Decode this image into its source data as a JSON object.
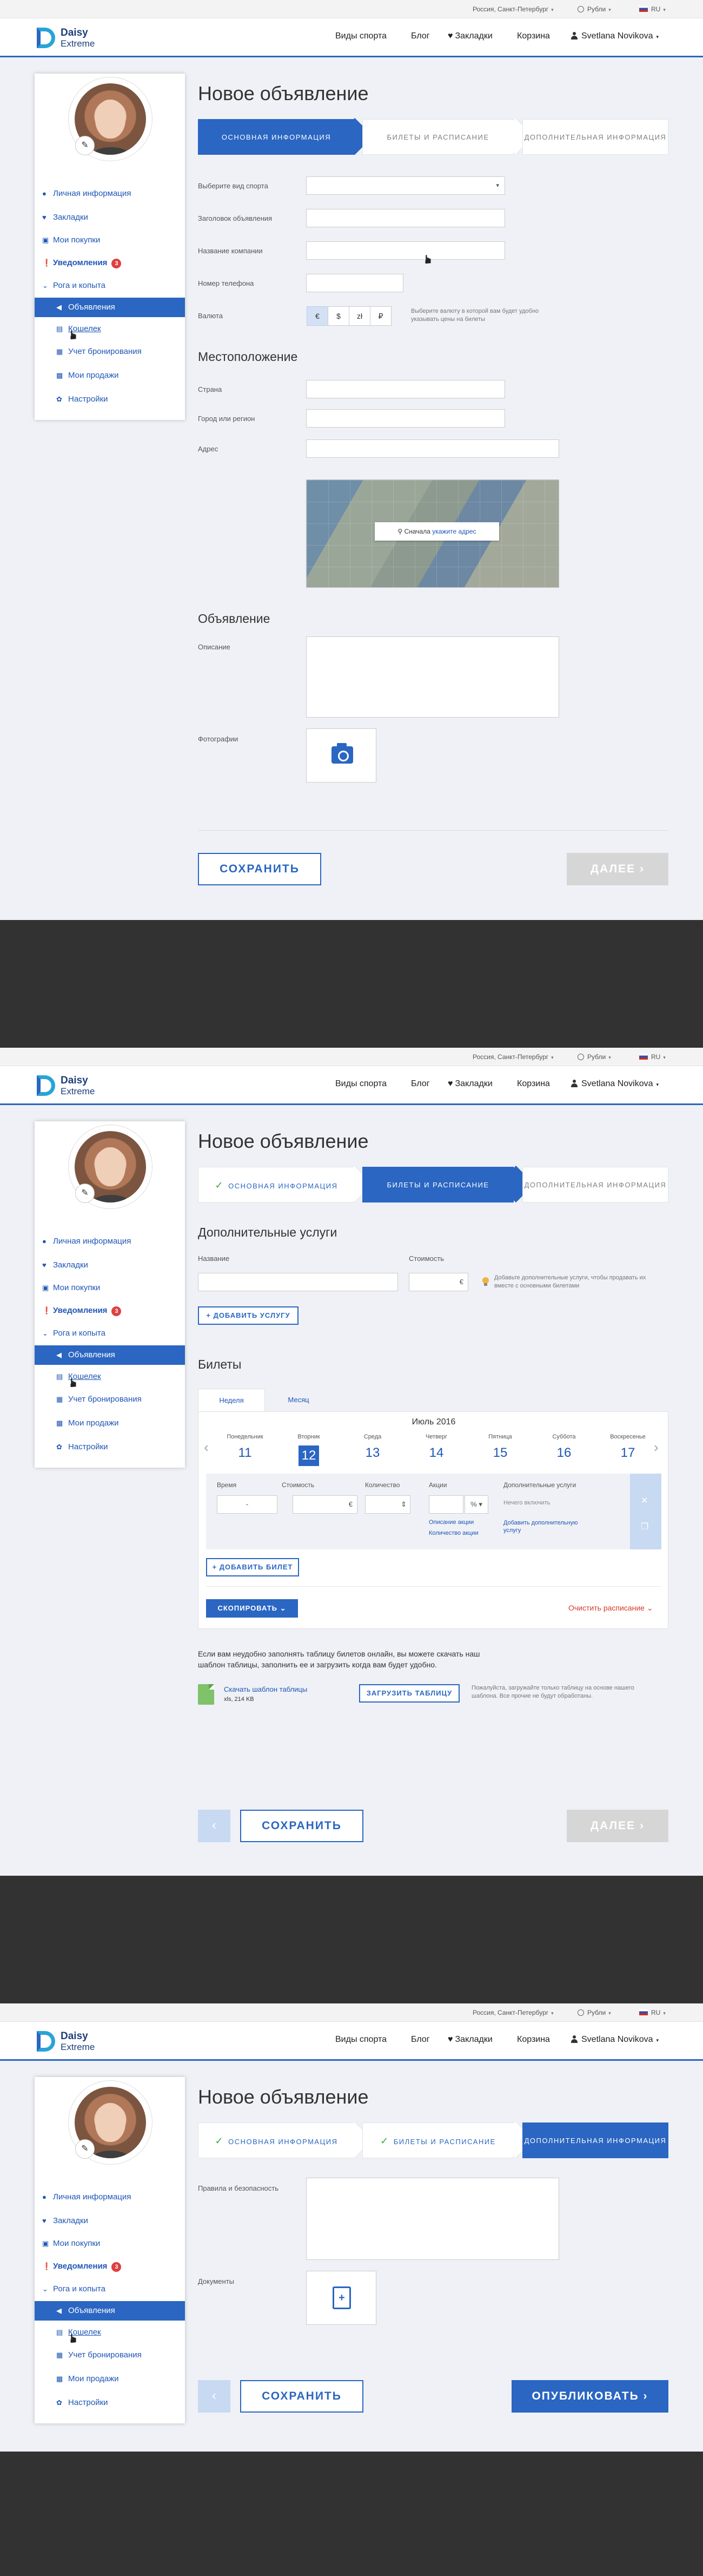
{
  "topbar": {
    "location": "Россия, Санкт-Петербург",
    "currency": "Рубли",
    "language": "RU"
  },
  "header": {
    "logo_line1": "Daisy",
    "logo_line2": "Extreme",
    "nav": [
      "Виды спорта",
      "Блог",
      "Закладки",
      "Корзина"
    ],
    "user": "Svetlana Novikova"
  },
  "sidebar": {
    "personal": "Личная информация",
    "bookmarks": "Закладки",
    "purchases": "Мои покупки",
    "notifications": "Уведомления",
    "notifications_count": "3",
    "group": "Рога и копыта",
    "ads": "Объявления",
    "wallet": "Кошелек",
    "booking": "Учет бронирования",
    "sales": "Мои продажи",
    "settings": "Настройки"
  },
  "page": {
    "title": "Новое объявление"
  },
  "steps": {
    "step1": "ОСНОВНАЯ ИНФОРМАЦИЯ",
    "step2": "БИЛЕТЫ И РАСПИСАНИЕ",
    "step3": "ДОПОЛНИТЕЛЬНАЯ ИНФОРМАЦИЯ"
  },
  "screen1": {
    "sport_label": "Выберите вид спорта",
    "headline_label": "Заголовок объявления",
    "company_label": "Название компании",
    "phone_label": "Номер телефона",
    "currency_label": "Валюта",
    "currency_options": [
      "€",
      "$",
      "zł",
      "₽"
    ],
    "currency_hint": "Выберите валюту в которой вам будет удобно указывать цены на билеты",
    "location_heading": "Местоположение",
    "country_label": "Страна",
    "city_label": "Город или регион",
    "address_label": "Адрес",
    "map_hint": "Сначала",
    "map_hint_link": "укажите адрес",
    "ad_heading": "Объявление",
    "description_label": "Описание",
    "photos_label": "Фотографии",
    "save": "СОХРАНИТЬ",
    "next": "ДАЛЕЕ"
  },
  "screen2": {
    "services_heading": "Дополнительные услуги",
    "name_label": "Название",
    "cost_label": "Стоимость",
    "cost_currency": "€",
    "services_hint": "Добавьте дополнительные услуги, чтобы продавать их вместе с основными билетами",
    "add_service": "+ ДОБАВИТЬ УСЛУГУ",
    "tickets_heading": "Билеты",
    "tab_week": "Неделя",
    "tab_month": "Месяц",
    "month": "Июль 2016",
    "days": [
      {
        "name": "Понедельник",
        "date": "11"
      },
      {
        "name": "Вторник",
        "date": "12"
      },
      {
        "name": "Среда",
        "date": "13"
      },
      {
        "name": "Четверг",
        "date": "14"
      },
      {
        "name": "Пятница",
        "date": "15"
      },
      {
        "name": "Суббота",
        "date": "16"
      },
      {
        "name": "Воскресенье",
        "date": "17"
      }
    ],
    "col_time": "Время",
    "col_cost": "Стоимость",
    "col_qty": "Количество",
    "col_promo": "Акции",
    "col_extra": "Дополнительные услуги",
    "time_value": "-",
    "cost_currency_small": "€",
    "promo_unit": "%",
    "promo_desc": "Описание акции",
    "promo_qty": "Количество акции",
    "extra_empty": "Нечего включить",
    "extra_add": "Добавить дополнительную услугу",
    "add_ticket": "+ ДОБАВИТЬ БИЛЕТ",
    "copy": "СКОПИРОВАТЬ",
    "clear_schedule": "Очистить расписание",
    "upload_text": "Если вам неудобно заполнять таблицу билетов онлайн, вы можете скачать наш шаблон таблицы, заполнить ее и загрузить когда вам будет удобно.",
    "download_link": "Скачать шаблон таблицы",
    "file_size": "xls, 214 KB",
    "upload_btn": "ЗАГРУЗИТЬ ТАБЛИЦУ",
    "upload_hint": "Пожалуйста, загружайте только таблицу на основе нашего шаблона. Все прочие не будут обработаны.",
    "save": "СОХРАНИТЬ",
    "next": "ДАЛЕЕ"
  },
  "screen3": {
    "rules_label": "Правила и безопасность",
    "docs_label": "Документы",
    "save": "СОХРАНИТЬ",
    "publish": "ОПУБЛИКОВАТЬ"
  },
  "colors": {
    "primary": "#2a66c2",
    "background": "#eff1f6",
    "dark": "#323232",
    "badge": "#e04040"
  }
}
